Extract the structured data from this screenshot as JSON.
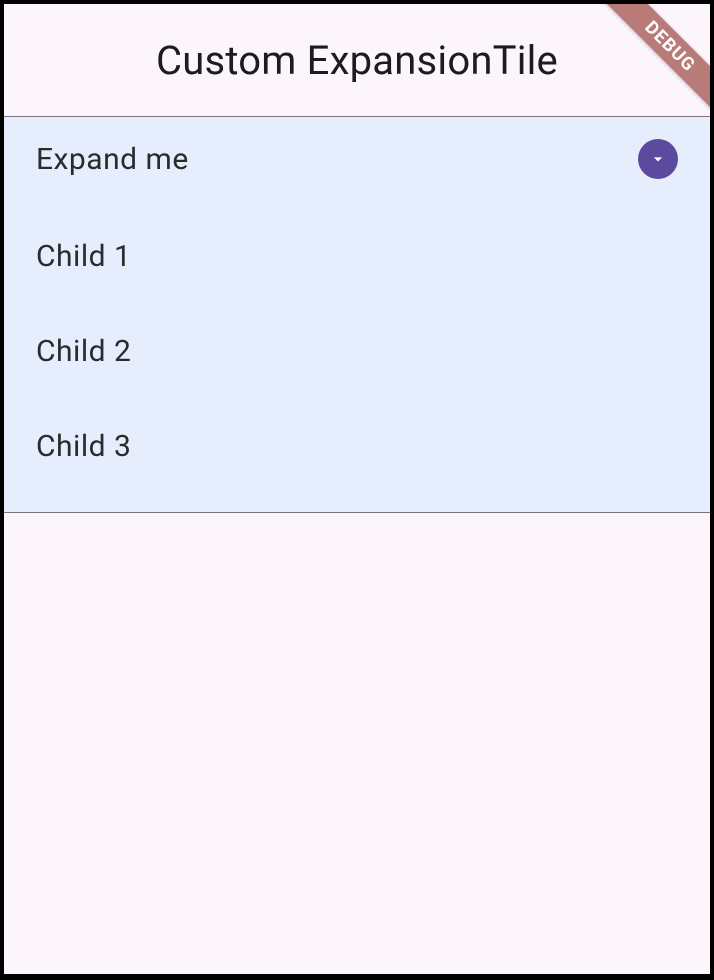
{
  "header": {
    "title": "Custom ExpansionTile",
    "debug_label": "DEBUG"
  },
  "tile": {
    "title": "Expand me",
    "expanded": true,
    "children": [
      {
        "label": "Child 1"
      },
      {
        "label": "Child 2"
      },
      {
        "label": "Child 3"
      }
    ]
  },
  "colors": {
    "accent": "#5b4a9e",
    "tile_bg": "#e6eefd",
    "page_bg": "#fcf5fb",
    "debug_banner": "#b97b78"
  }
}
